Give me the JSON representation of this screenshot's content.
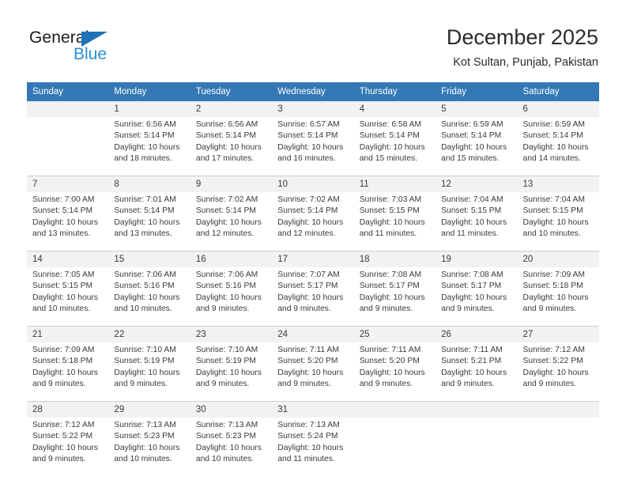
{
  "brand": {
    "name_part1": "General",
    "name_part2": "Blue",
    "flag_icon": "triangle-flag-icon",
    "accent_color": "#1f72b8",
    "blue_text_color": "#2a8fd4"
  },
  "header": {
    "title": "December 2025",
    "subtitle": "Kot Sultan, Punjab, Pakistan"
  },
  "theme": {
    "header_bar_color": "#3479b5",
    "daynum_bg_color": "#f2f2f2",
    "rule_color": "#cfcfcf",
    "text_color": "#3a3a3a"
  },
  "weekdays": [
    "Sunday",
    "Monday",
    "Tuesday",
    "Wednesday",
    "Thursday",
    "Friday",
    "Saturday"
  ],
  "weeks": [
    {
      "days": [
        {
          "num": "",
          "sunrise": "",
          "sunset": "",
          "daylight1": "",
          "daylight2": "",
          "empty": true
        },
        {
          "num": "1",
          "sunrise": "Sunrise: 6:56 AM",
          "sunset": "Sunset: 5:14 PM",
          "daylight1": "Daylight: 10 hours",
          "daylight2": "and 18 minutes.",
          "empty": false
        },
        {
          "num": "2",
          "sunrise": "Sunrise: 6:56 AM",
          "sunset": "Sunset: 5:14 PM",
          "daylight1": "Daylight: 10 hours",
          "daylight2": "and 17 minutes.",
          "empty": false
        },
        {
          "num": "3",
          "sunrise": "Sunrise: 6:57 AM",
          "sunset": "Sunset: 5:14 PM",
          "daylight1": "Daylight: 10 hours",
          "daylight2": "and 16 minutes.",
          "empty": false
        },
        {
          "num": "4",
          "sunrise": "Sunrise: 6:58 AM",
          "sunset": "Sunset: 5:14 PM",
          "daylight1": "Daylight: 10 hours",
          "daylight2": "and 15 minutes.",
          "empty": false
        },
        {
          "num": "5",
          "sunrise": "Sunrise: 6:59 AM",
          "sunset": "Sunset: 5:14 PM",
          "daylight1": "Daylight: 10 hours",
          "daylight2": "and 15 minutes.",
          "empty": false
        },
        {
          "num": "6",
          "sunrise": "Sunrise: 6:59 AM",
          "sunset": "Sunset: 5:14 PM",
          "daylight1": "Daylight: 10 hours",
          "daylight2": "and 14 minutes.",
          "empty": false
        }
      ]
    },
    {
      "days": [
        {
          "num": "7",
          "sunrise": "Sunrise: 7:00 AM",
          "sunset": "Sunset: 5:14 PM",
          "daylight1": "Daylight: 10 hours",
          "daylight2": "and 13 minutes.",
          "empty": false
        },
        {
          "num": "8",
          "sunrise": "Sunrise: 7:01 AM",
          "sunset": "Sunset: 5:14 PM",
          "daylight1": "Daylight: 10 hours",
          "daylight2": "and 13 minutes.",
          "empty": false
        },
        {
          "num": "9",
          "sunrise": "Sunrise: 7:02 AM",
          "sunset": "Sunset: 5:14 PM",
          "daylight1": "Daylight: 10 hours",
          "daylight2": "and 12 minutes.",
          "empty": false
        },
        {
          "num": "10",
          "sunrise": "Sunrise: 7:02 AM",
          "sunset": "Sunset: 5:14 PM",
          "daylight1": "Daylight: 10 hours",
          "daylight2": "and 12 minutes.",
          "empty": false
        },
        {
          "num": "11",
          "sunrise": "Sunrise: 7:03 AM",
          "sunset": "Sunset: 5:15 PM",
          "daylight1": "Daylight: 10 hours",
          "daylight2": "and 11 minutes.",
          "empty": false
        },
        {
          "num": "12",
          "sunrise": "Sunrise: 7:04 AM",
          "sunset": "Sunset: 5:15 PM",
          "daylight1": "Daylight: 10 hours",
          "daylight2": "and 11 minutes.",
          "empty": false
        },
        {
          "num": "13",
          "sunrise": "Sunrise: 7:04 AM",
          "sunset": "Sunset: 5:15 PM",
          "daylight1": "Daylight: 10 hours",
          "daylight2": "and 10 minutes.",
          "empty": false
        }
      ]
    },
    {
      "days": [
        {
          "num": "14",
          "sunrise": "Sunrise: 7:05 AM",
          "sunset": "Sunset: 5:15 PM",
          "daylight1": "Daylight: 10 hours",
          "daylight2": "and 10 minutes.",
          "empty": false
        },
        {
          "num": "15",
          "sunrise": "Sunrise: 7:06 AM",
          "sunset": "Sunset: 5:16 PM",
          "daylight1": "Daylight: 10 hours",
          "daylight2": "and 10 minutes.",
          "empty": false
        },
        {
          "num": "16",
          "sunrise": "Sunrise: 7:06 AM",
          "sunset": "Sunset: 5:16 PM",
          "daylight1": "Daylight: 10 hours",
          "daylight2": "and 9 minutes.",
          "empty": false
        },
        {
          "num": "17",
          "sunrise": "Sunrise: 7:07 AM",
          "sunset": "Sunset: 5:17 PM",
          "daylight1": "Daylight: 10 hours",
          "daylight2": "and 9 minutes.",
          "empty": false
        },
        {
          "num": "18",
          "sunrise": "Sunrise: 7:08 AM",
          "sunset": "Sunset: 5:17 PM",
          "daylight1": "Daylight: 10 hours",
          "daylight2": "and 9 minutes.",
          "empty": false
        },
        {
          "num": "19",
          "sunrise": "Sunrise: 7:08 AM",
          "sunset": "Sunset: 5:17 PM",
          "daylight1": "Daylight: 10 hours",
          "daylight2": "and 9 minutes.",
          "empty": false
        },
        {
          "num": "20",
          "sunrise": "Sunrise: 7:09 AM",
          "sunset": "Sunset: 5:18 PM",
          "daylight1": "Daylight: 10 hours",
          "daylight2": "and 9 minutes.",
          "empty": false
        }
      ]
    },
    {
      "days": [
        {
          "num": "21",
          "sunrise": "Sunrise: 7:09 AM",
          "sunset": "Sunset: 5:18 PM",
          "daylight1": "Daylight: 10 hours",
          "daylight2": "and 9 minutes.",
          "empty": false
        },
        {
          "num": "22",
          "sunrise": "Sunrise: 7:10 AM",
          "sunset": "Sunset: 5:19 PM",
          "daylight1": "Daylight: 10 hours",
          "daylight2": "and 9 minutes.",
          "empty": false
        },
        {
          "num": "23",
          "sunrise": "Sunrise: 7:10 AM",
          "sunset": "Sunset: 5:19 PM",
          "daylight1": "Daylight: 10 hours",
          "daylight2": "and 9 minutes.",
          "empty": false
        },
        {
          "num": "24",
          "sunrise": "Sunrise: 7:11 AM",
          "sunset": "Sunset: 5:20 PM",
          "daylight1": "Daylight: 10 hours",
          "daylight2": "and 9 minutes.",
          "empty": false
        },
        {
          "num": "25",
          "sunrise": "Sunrise: 7:11 AM",
          "sunset": "Sunset: 5:20 PM",
          "daylight1": "Daylight: 10 hours",
          "daylight2": "and 9 minutes.",
          "empty": false
        },
        {
          "num": "26",
          "sunrise": "Sunrise: 7:11 AM",
          "sunset": "Sunset: 5:21 PM",
          "daylight1": "Daylight: 10 hours",
          "daylight2": "and 9 minutes.",
          "empty": false
        },
        {
          "num": "27",
          "sunrise": "Sunrise: 7:12 AM",
          "sunset": "Sunset: 5:22 PM",
          "daylight1": "Daylight: 10 hours",
          "daylight2": "and 9 minutes.",
          "empty": false
        }
      ]
    },
    {
      "days": [
        {
          "num": "28",
          "sunrise": "Sunrise: 7:12 AM",
          "sunset": "Sunset: 5:22 PM",
          "daylight1": "Daylight: 10 hours",
          "daylight2": "and 9 minutes.",
          "empty": false
        },
        {
          "num": "29",
          "sunrise": "Sunrise: 7:13 AM",
          "sunset": "Sunset: 5:23 PM",
          "daylight1": "Daylight: 10 hours",
          "daylight2": "and 10 minutes.",
          "empty": false
        },
        {
          "num": "30",
          "sunrise": "Sunrise: 7:13 AM",
          "sunset": "Sunset: 5:23 PM",
          "daylight1": "Daylight: 10 hours",
          "daylight2": "and 10 minutes.",
          "empty": false
        },
        {
          "num": "31",
          "sunrise": "Sunrise: 7:13 AM",
          "sunset": "Sunset: 5:24 PM",
          "daylight1": "Daylight: 10 hours",
          "daylight2": "and 11 minutes.",
          "empty": false
        },
        {
          "num": "",
          "sunrise": "",
          "sunset": "",
          "daylight1": "",
          "daylight2": "",
          "empty": true
        },
        {
          "num": "",
          "sunrise": "",
          "sunset": "",
          "daylight1": "",
          "daylight2": "",
          "empty": true
        },
        {
          "num": "",
          "sunrise": "",
          "sunset": "",
          "daylight1": "",
          "daylight2": "",
          "empty": true
        }
      ]
    }
  ]
}
